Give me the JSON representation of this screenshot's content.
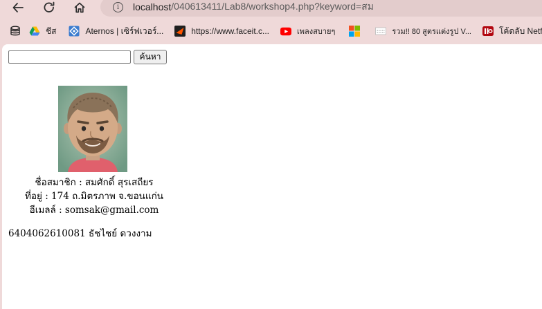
{
  "browser": {
    "url_host": "localhost",
    "url_path": "/040613411/Lab8/workshop4.php?keyword=สม",
    "bookmarks": [
      {
        "label": "",
        "icon": "database-icon"
      },
      {
        "label": "ชีส",
        "icon": "google-drive-icon"
      },
      {
        "label": "Aternos | เซิร์ฟเวอร์...",
        "icon": "aternos-icon"
      },
      {
        "label": "https://www.faceit.c...",
        "icon": "faceit-icon"
      },
      {
        "label": "เพลงสบายๆ",
        "icon": "youtube-icon"
      },
      {
        "label": "",
        "icon": "microsoft-icon"
      },
      {
        "label": "รวม!! 80 สูตรแต่งรูป V...",
        "icon": "page-icon"
      },
      {
        "label": "โค้ดลับ Netflix",
        "icon": "netflix-icon"
      }
    ]
  },
  "search": {
    "value": "",
    "placeholder": "",
    "button_label": "ค้นหา"
  },
  "member": {
    "name_line": "ชื่อสมาชิก : สมศักดิ์ สุรเสถียร",
    "address_line": "ที่อยู่ : 174 ถ.มิตรภาพ จ.ขอนแก่น",
    "email_line": "อีเมลล์ : somsak@gmail.com"
  },
  "footer": {
    "student": "6404062610081 ธัชไชย์ ดวงงาม"
  },
  "colors": {
    "chrome_bg": "#efd9d9",
    "address_bg": "#e3cccc",
    "page_bg": "#ffffff"
  }
}
